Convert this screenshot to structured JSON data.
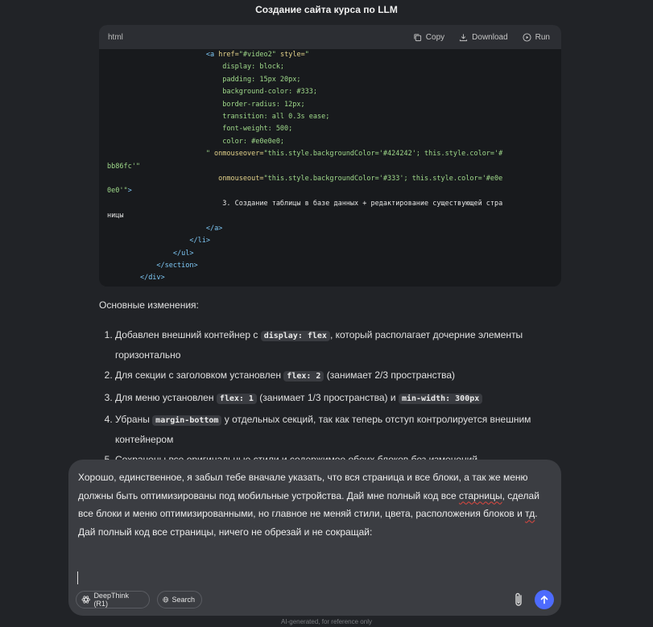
{
  "title": "Создание сайта курса по LLM",
  "code": {
    "lang": "html",
    "copy_label": "Copy",
    "download_label": "Download",
    "run_label": "Run",
    "lines": [
      [
        {
          "t": "                        ",
          "k": "c-text"
        },
        {
          "t": "<a",
          "k": "c-tag"
        },
        {
          "t": " href=",
          "k": "c-attr"
        },
        {
          "t": "\"#video2\"",
          "k": "c-str"
        },
        {
          "t": " style=",
          "k": "c-attr"
        },
        {
          "t": "\"",
          "k": "c-str"
        }
      ],
      [
        {
          "t": "                            display: block;",
          "k": "c-str"
        }
      ],
      [
        {
          "t": "                            padding: 15px 20px;",
          "k": "c-str"
        }
      ],
      [
        {
          "t": "                            background-color: #333;",
          "k": "c-str"
        }
      ],
      [
        {
          "t": "                            border-radius: 12px;",
          "k": "c-str"
        }
      ],
      [
        {
          "t": "                            transition: all 0.3s ease;",
          "k": "c-str"
        }
      ],
      [
        {
          "t": "                            font-weight: 500;",
          "k": "c-str"
        }
      ],
      [
        {
          "t": "                            color: #e0e0e0;",
          "k": "c-str"
        }
      ],
      [
        {
          "t": "                        \"",
          "k": "c-str"
        },
        {
          "t": " onmouseover=",
          "k": "c-attr"
        },
        {
          "t": "\"this.style.backgroundColor='#424242'; this.style.color='#",
          "k": "c-str"
        }
      ],
      [
        {
          "t": "bb86fc'\"",
          "k": "c-str"
        }
      ],
      [
        {
          "t": "                           onmouseout=",
          "k": "c-attr"
        },
        {
          "t": "\"this.style.backgroundColor='#333'; this.style.color='#e0e",
          "k": "c-str"
        }
      ],
      [
        {
          "t": "0e0'\"",
          "k": "c-str"
        },
        {
          "t": ">",
          "k": "c-tag"
        }
      ],
      [
        {
          "t": "                            3. Создание таблицы в базе данных + редактирование существующей стра",
          "k": "c-text"
        }
      ],
      [
        {
          "t": "ницы",
          "k": "c-text"
        }
      ],
      [
        {
          "t": "                        ",
          "k": "c-text"
        },
        {
          "t": "</a>",
          "k": "c-tag"
        }
      ],
      [
        {
          "t": "                    ",
          "k": "c-text"
        },
        {
          "t": "</li>",
          "k": "c-tag"
        }
      ],
      [
        {
          "t": "                ",
          "k": "c-text"
        },
        {
          "t": "</ul>",
          "k": "c-tag"
        }
      ],
      [
        {
          "t": "            ",
          "k": "c-text"
        },
        {
          "t": "</section>",
          "k": "c-tag"
        }
      ],
      [
        {
          "t": "        ",
          "k": "c-text"
        },
        {
          "t": "</div>",
          "k": "c-tag"
        }
      ]
    ]
  },
  "response": {
    "heading": "Основные изменения:",
    "items": [
      {
        "pre": "Добавлен внешний контейнер с ",
        "code": "display: flex",
        "post": ", который располагает дочерние элементы горизонтально"
      },
      {
        "pre": "Для секции с заголовком установлен ",
        "code": "flex: 2",
        "post": " (занимает 2/3 пространства)"
      },
      {
        "pre": "Для меню установлен ",
        "code": "flex: 1",
        "post": " (занимает 1/3 пространства) и ",
        "code2": "min-width: 300px",
        "post2": ""
      },
      {
        "pre": "Убраны ",
        "code": "margin-bottom",
        "post": " у отдельных секций, так как теперь отступ контролируется внешним контейнером"
      },
      {
        "pre": "Сохранены все оригинальные стили и содержимое обоих блоков без изменений",
        "code": "",
        "post": ""
      }
    ]
  },
  "input": {
    "text_parts": [
      {
        "t": "Хорошо, единственное, я забыл тебе вначале указать, что вся страница и все блоки, а так же меню должны быть оптимизированы под мобильные устройства. Дай мне полный код все ",
        "err": false
      },
      {
        "t": "старницы",
        "err": true
      },
      {
        "t": ", сделай все блоки и меню оптимизированными, но главное не меняй стили, цвета, расположения блоков и ",
        "err": false
      },
      {
        "t": "тд",
        "err": true
      },
      {
        "t": ". Дай полный код все страницы, ничего не обрезай и не сокращай:",
        "err": false
      }
    ],
    "deepthink_label": "DeepThink (R1)",
    "search_label": "Search"
  },
  "footer": "AI-generated, for reference only",
  "colors": {
    "send_button": "#4d6bfe",
    "background": "#212327"
  }
}
